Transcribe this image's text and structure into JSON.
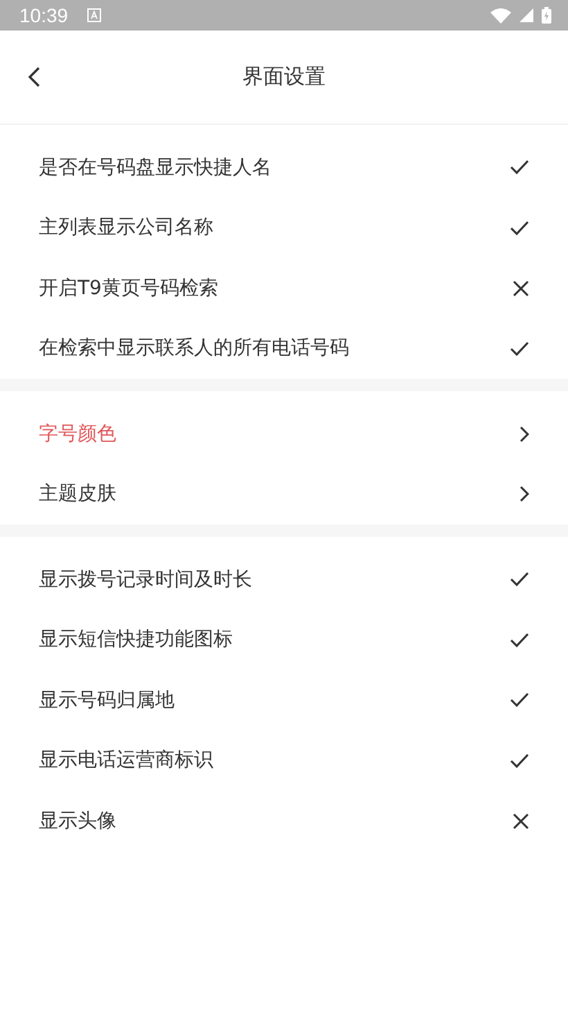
{
  "status_bar": {
    "time": "10:39"
  },
  "header": {
    "title": "界面设置"
  },
  "groups": [
    {
      "items": [
        {
          "kind": "toggle",
          "label": "是否在号码盘显示快捷人名",
          "checked": true
        },
        {
          "kind": "toggle",
          "label": "主列表显示公司名称",
          "checked": true
        },
        {
          "kind": "toggle",
          "label": "开启T9黄页号码检索",
          "checked": false
        },
        {
          "kind": "toggle",
          "label": "在检索中显示联系人的所有电话号码",
          "checked": true
        }
      ]
    },
    {
      "items": [
        {
          "kind": "link",
          "label": "字号颜色",
          "highlighted": true
        },
        {
          "kind": "link",
          "label": "主题皮肤",
          "highlighted": false
        }
      ]
    },
    {
      "items": [
        {
          "kind": "toggle",
          "label": "显示拨号记录时间及时长",
          "checked": true
        },
        {
          "kind": "toggle",
          "label": "显示短信快捷功能图标",
          "checked": true
        },
        {
          "kind": "toggle",
          "label": "显示号码归属地",
          "checked": true
        },
        {
          "kind": "toggle",
          "label": "显示电话运营商标识",
          "checked": true
        },
        {
          "kind": "toggle",
          "label": "显示头像",
          "checked": false
        }
      ]
    }
  ]
}
